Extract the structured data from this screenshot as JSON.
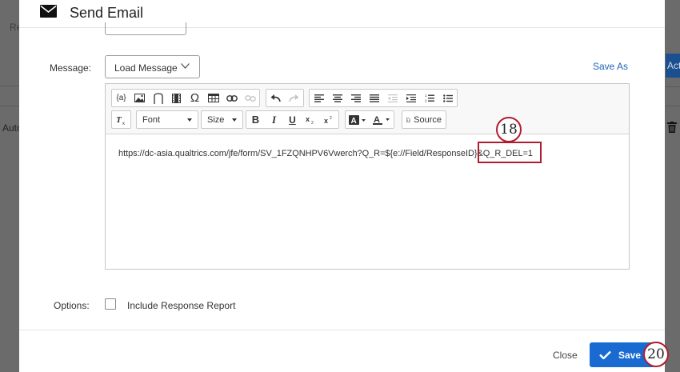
{
  "background": {
    "left_text_top": "Re",
    "left_text_mid": "Auto",
    "right_button_text": "Act"
  },
  "modal": {
    "title": "Send Email",
    "message_label": "Message:",
    "load_message_label": "Load Message",
    "save_as_label": "Save As",
    "toolbar": {
      "font_label": "Font",
      "size_label": "Size",
      "source_label": "Source",
      "placeholder_button_label": "{a}",
      "omega_label": "Ω",
      "bold_label": "B",
      "italic_label": "I",
      "underline_label": "U"
    },
    "editor_content": "https://dc-asia.qualtrics.com/jfe/form/SV_1FZQNHPV6Vwerch?Q_R=${e://Field/ResponseID}&Q_R_DEL=1",
    "options_label": "Options:",
    "include_response_report_label": "Include Response Report",
    "include_response_report_checked": false,
    "close_label": "Close",
    "save_label": "Save"
  },
  "callouts": {
    "step_18": "18",
    "step_20": "20"
  },
  "colors": {
    "accent": "#1a6bd1",
    "link": "#1f63b5",
    "callout_border": "#b01c2e",
    "overlay": "#6b6b6b"
  }
}
